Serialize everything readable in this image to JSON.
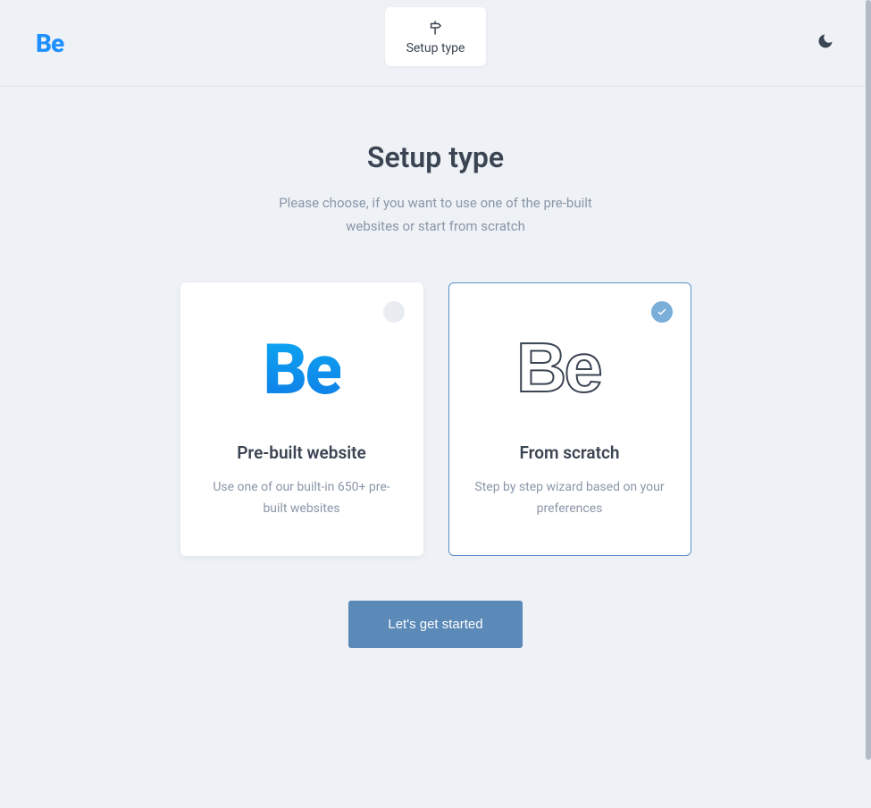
{
  "header": {
    "logo": "Be",
    "tab": {
      "label": "Setup type",
      "icon": "signpost-icon"
    },
    "darkmode_icon": "moon-icon"
  },
  "main": {
    "title": "Setup type",
    "subtitle": "Please choose, if you want to use one of the pre-built websites or start from scratch",
    "cards": [
      {
        "id": "prebuilt",
        "title": "Pre-built website",
        "desc": "Use one of our built-in 650+ pre-built websites",
        "selected": false
      },
      {
        "id": "scratch",
        "title": "From scratch",
        "desc": "Step by step wizard based on your preferences",
        "selected": true
      }
    ],
    "cta_label": "Let's get started"
  }
}
